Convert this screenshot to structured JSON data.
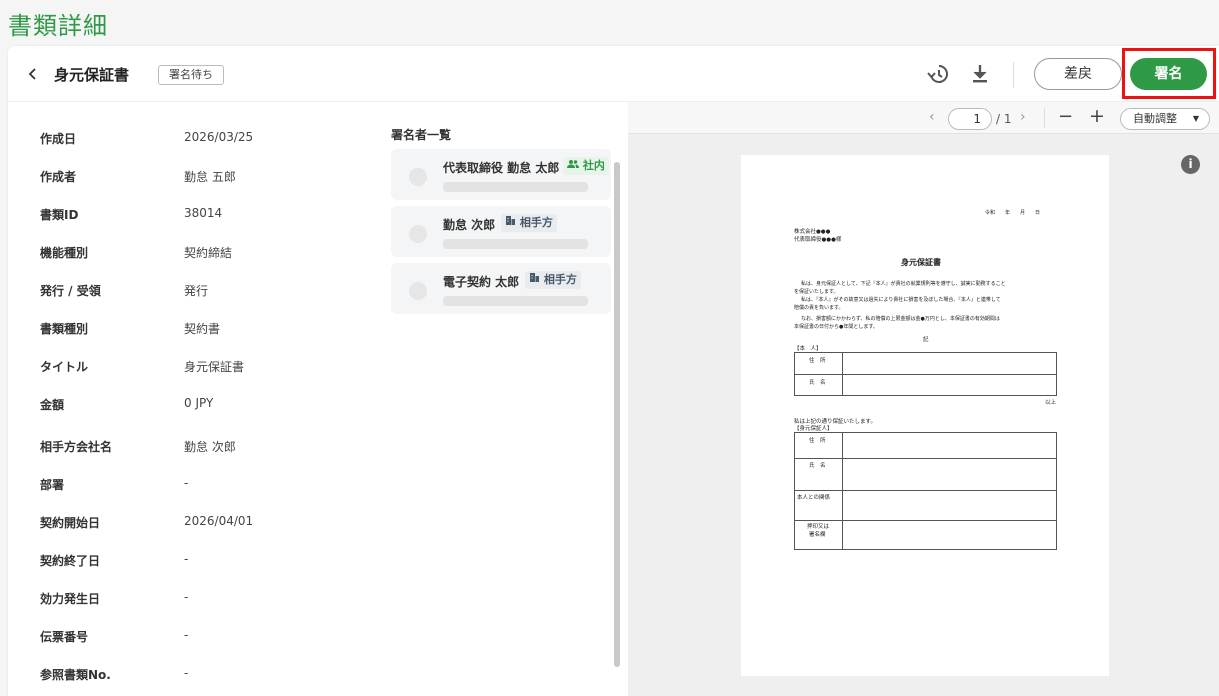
{
  "page": {
    "title": "書類詳細"
  },
  "header": {
    "doc_title": "身元保証書",
    "status_badge": "署名待ち",
    "return_label": "差戻",
    "sign_label": "署名"
  },
  "details": [
    {
      "label": "作成日",
      "value": "2026/03/25"
    },
    {
      "label": "作成者",
      "value": "勤怠 五郎"
    },
    {
      "label": "書類ID",
      "value": "38014"
    },
    {
      "label": "機能種別",
      "value": "契約締結"
    },
    {
      "label": "発行 / 受領",
      "value": "発行"
    },
    {
      "label": "書類種別",
      "value": "契約書"
    },
    {
      "label": "タイトル",
      "value": "身元保証書"
    },
    {
      "label": "金額",
      "value": "0 JPY"
    },
    {
      "label": "相手方会社名",
      "value": "勤怠 次郎"
    },
    {
      "label": "部署",
      "value": "-"
    },
    {
      "label": "契約開始日",
      "value": "2026/04/01"
    },
    {
      "label": "契約終了日",
      "value": "-"
    },
    {
      "label": "効力発生日",
      "value": "-"
    },
    {
      "label": "伝票番号",
      "value": "-"
    },
    {
      "label": "参照書類No.",
      "value": "-"
    }
  ],
  "signers": {
    "title": "署名者一覧",
    "items": [
      {
        "name": "代表取締役 勤怠 太郎",
        "tag": "社内",
        "tag_color": "#2e9a46",
        "tag_bg": "#e6f4ea"
      },
      {
        "name": "勤怠 次郎",
        "tag": "相手方",
        "tag_color": "#4a5a6a",
        "tag_bg": "#e8ecef"
      },
      {
        "name": "電子契約 太郎",
        "tag": "相手方",
        "tag_color": "#4a5a6a",
        "tag_bg": "#e8ecef"
      }
    ]
  },
  "viewer": {
    "page_current": "1",
    "page_total": "/ 1",
    "zoom_label": "自動調整"
  },
  "document": {
    "date_line": "令和　　年　　月　　日",
    "addressee_company": "株式会社●●●",
    "addressee_person": "代表取締役●●●様",
    "heading": "身元保証書",
    "para1a": "私は、身元保証人として、下記『本人』が貴社の就業規則等を遵守し、誠実に勤務すること",
    "para1b": "を保証いたします。",
    "para2a": "私は、『本人』がその故意又は過失により貴社に損害を及ぼした場合、『本人』と連帯して",
    "para2b": "賠償の責を負います。",
    "para3a": "なお、損害額にかかわらず、私の賠償の上限金額は金●万円とし、本保証書の有効期間は",
    "para3b": "本保証書の日付から●年間とします。",
    "ki": "記",
    "section_person": "【本　人】",
    "address_label": "住　所",
    "name_label": "氏　名",
    "ijo": "以上",
    "guarantee_line": "私は上記の通り保証いたします。",
    "section_guarantor": "【身元保証人】",
    "relation_label": "本人との関係",
    "seal_label_1": "押印又は",
    "seal_label_2": "署名欄"
  },
  "colors": {
    "brand_green": "#2e9a46",
    "highlight_red": "#e11111"
  }
}
